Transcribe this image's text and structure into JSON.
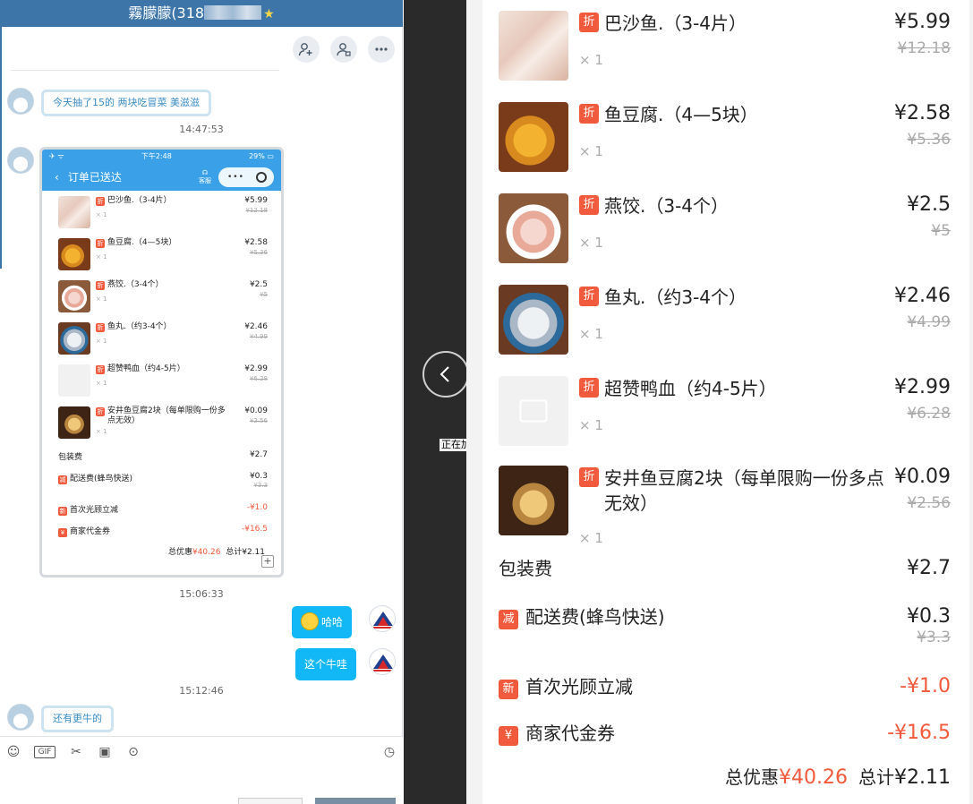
{
  "chat": {
    "title_prefix": "霧朦朦(318",
    "messages": [
      {
        "text": "今天抽了15的  两块吃冒菜 美滋滋"
      },
      {
        "text": "哈哈"
      },
      {
        "text": "这个牛哇"
      },
      {
        "text": "还有更牛的"
      }
    ],
    "timestamps": [
      "14:47:53",
      "15:06:33",
      "15:12:46"
    ],
    "input_icons": [
      "emoji-icon",
      "gif-icon",
      "scissors-icon",
      "image-icon",
      "more-icon"
    ]
  },
  "mini": {
    "status_time": "下午2:48",
    "status_battery": "29%",
    "header_title": "订单已送达",
    "cs_label": "客服"
  },
  "order": {
    "items": [
      {
        "name": "巴沙鱼.（3-4片）",
        "qty": "× 1",
        "price": "¥5.99",
        "orig": "¥12.18",
        "badge": "折",
        "mini_name": "巴沙鱼.（3-4片）",
        "thumb": "f-fish"
      },
      {
        "name": "鱼豆腐.（4—5块）",
        "qty": "× 1",
        "price": "¥2.58",
        "orig": "¥5.36",
        "badge": "折",
        "mini_name": "鱼豆腐.（4—5块）",
        "thumb": "f-tofu"
      },
      {
        "name": "燕饺.（3-4个）",
        "qty": "× 1",
        "price": "¥2.5",
        "orig": "¥5",
        "badge": "折",
        "mini_name": "燕饺.（3-4个）",
        "thumb": "f-dump"
      },
      {
        "name": "鱼丸.（约3-4个）",
        "qty": "× 1",
        "price": "¥2.46",
        "orig": "¥4.99",
        "badge": "折",
        "mini_name": "鱼丸.（约3-4个）",
        "thumb": "f-ball"
      },
      {
        "name": "超赞鸭血（约4-5片）",
        "qty": "× 1",
        "price": "¥2.99",
        "orig": "¥6.28",
        "badge": "折",
        "mini_name": "超赞鸭血（约4-5片）",
        "thumb": "f-none"
      },
      {
        "name": "安井鱼豆腐2块（每单限购一份多点无效）",
        "qty": "× 1",
        "price": "¥0.09",
        "orig": "¥2.56",
        "badge": "折",
        "mini_name": "安井鱼豆腐2块（每单限购一份多点无效）",
        "thumb": "f-anj"
      }
    ],
    "packaging": {
      "label": "包装费",
      "value": "¥2.7"
    },
    "delivery": {
      "badge": "减",
      "label": "配送费(蜂鸟快送)",
      "value": "¥0.3",
      "orig": "¥3.3"
    },
    "first_visit": {
      "badge": "新",
      "label": "首次光顾立减",
      "value": "-¥1.0"
    },
    "coupon": {
      "badge": "¥",
      "label": "商家代金券",
      "value": "-¥16.5"
    },
    "discount_label": "总优惠",
    "discount_value": "¥40.26",
    "total_label": "总计",
    "total_value": "¥2.11"
  },
  "viewer": {
    "loading_text": "正在加载"
  },
  "colors": {
    "titlebar": "#3d75a9",
    "accent_blue": "#12b7f5",
    "discount_red": "#f25a3d"
  }
}
